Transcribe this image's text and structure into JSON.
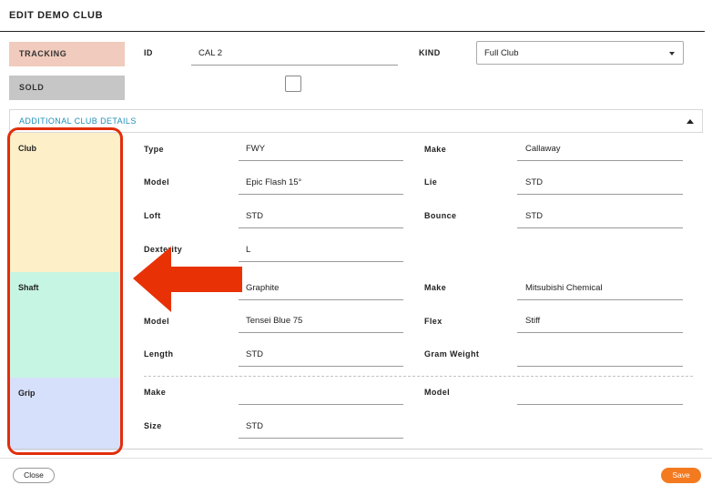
{
  "header": {
    "title": "EDIT DEMO CLUB"
  },
  "tags": {
    "tracking": "TRACKING",
    "sold": "SOLD"
  },
  "top_fields": {
    "id_label": "ID",
    "id_value": "CAL 2",
    "kind_label": "KIND",
    "kind_value": "Full Club"
  },
  "section": {
    "title": "ADDITIONAL CLUB DETAILS"
  },
  "groups": {
    "club": {
      "label": "Club",
      "type_label": "Type",
      "type_value": "FWY",
      "make_label": "Make",
      "make_value": "Callaway",
      "model_label": "Model",
      "model_value": "Epic Flash 15°",
      "lie_label": "Lie",
      "lie_value": "STD",
      "loft_label": "Loft",
      "loft_value": "STD",
      "bounce_label": "Bounce",
      "bounce_value": "STD",
      "dexterity_label": "Dexterity",
      "dexterity_value": "L"
    },
    "shaft": {
      "label": "Shaft",
      "type_value": "Graphite",
      "make_label": "Make",
      "make_value": "Mitsubishi Chemical",
      "model_label": "Model",
      "model_value": "Tensei Blue 75",
      "flex_label": "Flex",
      "flex_value": "Stiff",
      "length_label": "Length",
      "length_value": "STD",
      "gram_weight_label": "Gram Weight",
      "gram_weight_value": ""
    },
    "grip": {
      "label": "Grip",
      "make_label": "Make",
      "make_value": "",
      "model_label": "Model",
      "model_value": "",
      "size_label": "Size",
      "size_value": "STD"
    }
  },
  "footer": {
    "close_label": "Close",
    "save_label": "Save"
  },
  "colors": {
    "accent": "#f47a20",
    "link": "#1f8fb8",
    "highlight": "#e12e0c",
    "tracking_bg": "#f1cbbd",
    "sold_bg": "#c6c6c6",
    "club_bg": "#fdefc8",
    "shaft_bg": "#c7f5e3",
    "grip_bg": "#d7e0fa"
  }
}
